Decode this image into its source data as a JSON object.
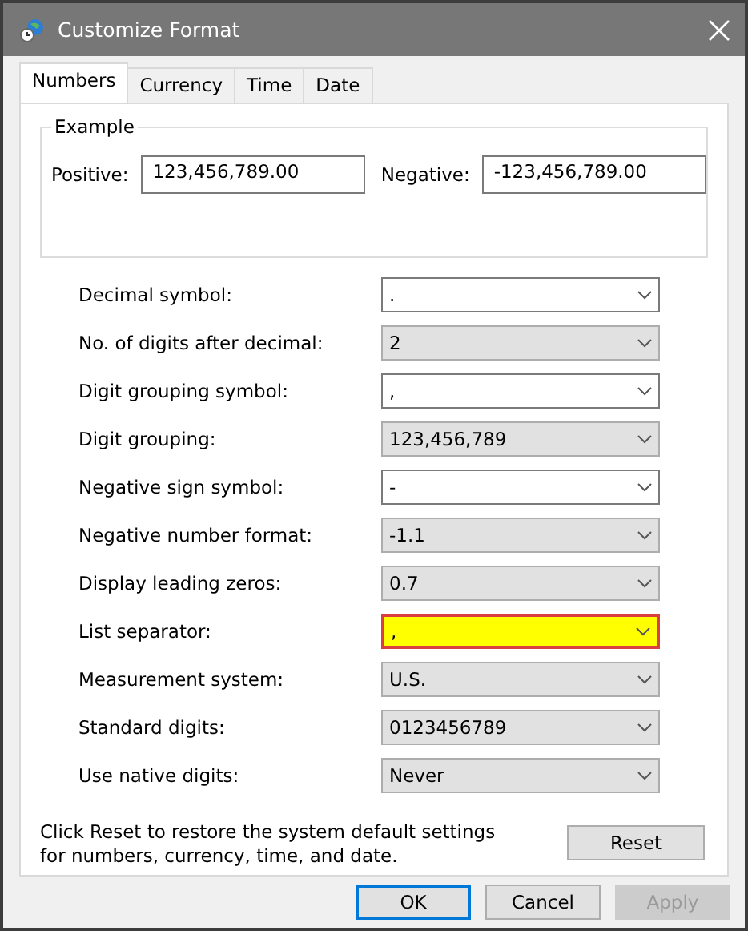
{
  "window": {
    "title": "Customize Format"
  },
  "tabs": [
    {
      "label": "Numbers",
      "selected": true
    },
    {
      "label": "Currency",
      "selected": false
    },
    {
      "label": "Time",
      "selected": false
    },
    {
      "label": "Date",
      "selected": false
    }
  ],
  "example": {
    "title": "Example",
    "positive_label": "Positive:",
    "positive_value": "123,456,789.00",
    "negative_label": "Negative:",
    "negative_value": "-123,456,789.00"
  },
  "settings": [
    {
      "label": "Decimal symbol:",
      "value": ".",
      "kind": "editable",
      "highlighted": false
    },
    {
      "label": "No. of digits after decimal:",
      "value": "2",
      "kind": "list",
      "highlighted": false
    },
    {
      "label": "Digit grouping symbol:",
      "value": ",",
      "kind": "editable",
      "highlighted": false
    },
    {
      "label": "Digit grouping:",
      "value": "123,456,789",
      "kind": "list",
      "highlighted": false
    },
    {
      "label": "Negative sign symbol:",
      "value": "-",
      "kind": "editable",
      "highlighted": false
    },
    {
      "label": "Negative number format:",
      "value": "-1.1",
      "kind": "list",
      "highlighted": false
    },
    {
      "label": "Display leading zeros:",
      "value": "0.7",
      "kind": "list",
      "highlighted": false
    },
    {
      "label": "List separator:",
      "value": ",",
      "kind": "editable",
      "highlighted": true
    },
    {
      "label": "Measurement system:",
      "value": "U.S.",
      "kind": "list",
      "highlighted": false
    },
    {
      "label": "Standard digits:",
      "value": "0123456789",
      "kind": "list",
      "highlighted": false
    },
    {
      "label": "Use native digits:",
      "value": "Never",
      "kind": "list",
      "highlighted": false
    }
  ],
  "reset_note": "Click Reset to restore the system default settings for numbers, currency, time, and date.",
  "reset_button": "Reset",
  "buttons": [
    {
      "label": "OK",
      "default": true,
      "disabled": false
    },
    {
      "label": "Cancel",
      "default": false,
      "disabled": false
    },
    {
      "label": "Apply",
      "default": false,
      "disabled": true
    }
  ]
}
